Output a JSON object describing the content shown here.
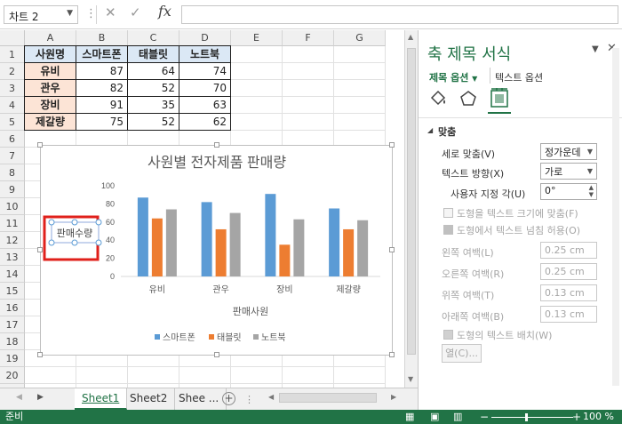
{
  "formula_bar": {
    "name_box": "차트 2",
    "formula": ""
  },
  "columns": [
    "A",
    "B",
    "C",
    "D",
    "E",
    "F",
    "G"
  ],
  "rows": [
    "1",
    "2",
    "3",
    "4",
    "5",
    "6",
    "7",
    "8",
    "9",
    "10",
    "11",
    "12",
    "13",
    "14",
    "15",
    "16",
    "17",
    "18",
    "19",
    "20",
    "21"
  ],
  "table": {
    "headers": [
      "사원명",
      "스마트폰",
      "태블릿",
      "노트북"
    ],
    "data": [
      [
        "유비",
        "87",
        "64",
        "74"
      ],
      [
        "관우",
        "82",
        "52",
        "70"
      ],
      [
        "장비",
        "91",
        "35",
        "63"
      ],
      [
        "제갈량",
        "75",
        "52",
        "62"
      ]
    ]
  },
  "chart_data": {
    "type": "bar",
    "title": "사원별 전자제품 판매량",
    "xlabel": "판매사원",
    "ylabel": "판매수량",
    "categories": [
      "유비",
      "관우",
      "장비",
      "제갈량"
    ],
    "series": [
      {
        "name": "스마트폰",
        "values": [
          87,
          82,
          91,
          75
        ],
        "color": "#5b9bd5"
      },
      {
        "name": "태블릿",
        "values": [
          64,
          52,
          35,
          52
        ],
        "color": "#ed7d31"
      },
      {
        "name": "노트북",
        "values": [
          74,
          70,
          63,
          62
        ],
        "color": "#a5a5a5"
      }
    ],
    "yticks": [
      "0",
      "20",
      "40",
      "60",
      "80",
      "100"
    ],
    "ylim": [
      0,
      100
    ],
    "legend": "bottom",
    "grid": false
  },
  "sheet_tabs": [
    "Sheet1",
    "Sheet2",
    "Shee ..."
  ],
  "active_tab": "Sheet1",
  "status": {
    "ready": "준비",
    "zoom": "100 %"
  },
  "pane": {
    "title": "축 제목 서식",
    "tab_title_options": "제목 옵션",
    "tab_text_options": "텍스트 옵션",
    "section": "맞춤",
    "vertical_align_label": "세로 맞춤(V)",
    "vertical_align_value": "정가운데",
    "text_direction_label": "텍스트 방향(X)",
    "text_direction_value": "가로",
    "custom_angle_label": "사용자 지정 각(U)",
    "custom_angle_value": "0°",
    "resize_shape_label": "도형을 텍스트 크기에 맞춤(F)",
    "wrap_text_label": "도형에서 텍스트 넘침 허용(O)",
    "left_margin_label": "왼쪽 여백(L)",
    "left_margin_value": "0.25 cm",
    "right_margin_label": "오른쪽 여백(R)",
    "right_margin_value": "0.25 cm",
    "top_margin_label": "위쪽 여백(T)",
    "top_margin_value": "0.13 cm",
    "bottom_margin_label": "아래쪽 여백(B)",
    "bottom_margin_value": "0.13 cm",
    "wrap_shape_label": "도형의 텍스트 배치(W)",
    "columns_button": "열(C)..."
  }
}
